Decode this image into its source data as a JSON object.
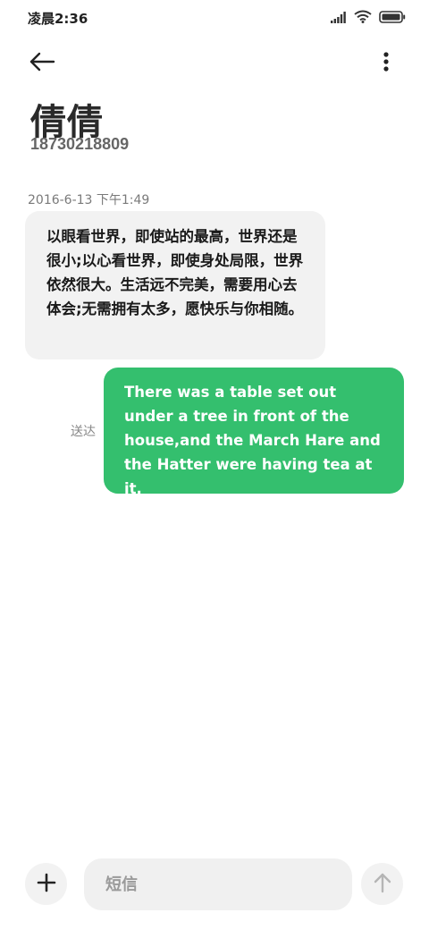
{
  "status_bar": {
    "time": "凌晨2:36",
    "icons": [
      "signal-icon",
      "wifi-icon",
      "battery-icon"
    ]
  },
  "header": {
    "back_icon": "back-arrow-icon",
    "more_icon": "more-vertical-icon"
  },
  "contact": {
    "name": "倩倩",
    "phone": "18730218809"
  },
  "conversation": {
    "timestamp": "2016-6-13 下午1:49",
    "messages": [
      {
        "direction": "incoming",
        "text": "以眼看世界，即使站的最高，世界还是很小;以心看世界，即使身处局限，世界依然很大。生活远不完美，需要用心去体会;无需拥有太多，愿快乐与你相随。"
      },
      {
        "direction": "outgoing",
        "text": "There was a table set out under a tree in front of the house,and the March Hare and the Hatter were having tea at it.",
        "status": "送达"
      }
    ]
  },
  "composer": {
    "placeholder": "短信",
    "add_icon": "plus-icon",
    "send_icon": "send-arrow-icon"
  },
  "colors": {
    "outgoing_bubble": "#34bf6e",
    "incoming_bubble": "#f2f2f2",
    "background": "#ffffff"
  }
}
